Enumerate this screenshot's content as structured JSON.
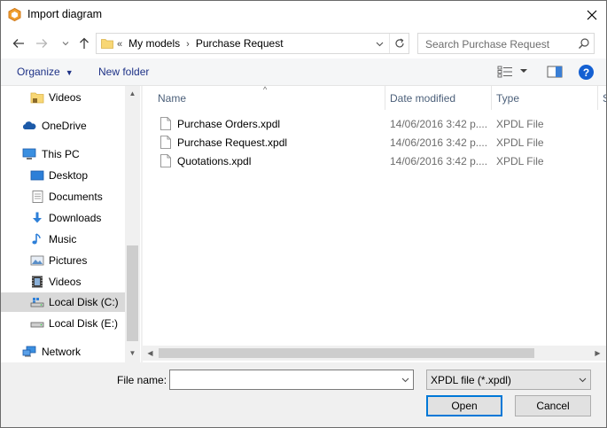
{
  "window": {
    "title": "Import diagram",
    "app_icon": "app-logo-icon",
    "close_icon": "close-icon"
  },
  "nav": {
    "back_icon": "back-arrow-icon",
    "forward_icon": "forward-arrow-icon",
    "recent_icon": "chevron-down-icon",
    "up_icon": "up-arrow-icon",
    "address": {
      "overflow_glyph": "«",
      "crumbs": [
        "My models",
        "Purchase Request"
      ],
      "separator": "›"
    },
    "search_placeholder": "Search Purchase Request"
  },
  "toolbar": {
    "organize_label": "Organize",
    "organize_caret": "▼",
    "new_folder_label": "New folder",
    "help_label": "?"
  },
  "sidebar": {
    "items": [
      {
        "label": "Videos",
        "icon": "folder-icon"
      },
      {
        "label": "OneDrive",
        "icon": "cloud-icon"
      },
      {
        "label": "This PC",
        "icon": "computer-icon"
      },
      {
        "label": "Desktop",
        "icon": "desktop-icon"
      },
      {
        "label": "Documents",
        "icon": "documents-icon"
      },
      {
        "label": "Downloads",
        "icon": "download-arrow-icon"
      },
      {
        "label": "Music",
        "icon": "music-note-icon"
      },
      {
        "label": "Pictures",
        "icon": "pictures-icon"
      },
      {
        "label": "Videos",
        "icon": "film-icon"
      },
      {
        "label": "Local Disk (C:)",
        "icon": "drive-icon"
      },
      {
        "label": "Local Disk (E:)",
        "icon": "drive-icon"
      },
      {
        "label": "Network",
        "icon": "network-icon"
      }
    ],
    "selected": "Local Disk (C:)"
  },
  "filelist": {
    "columns": [
      "Name",
      "Date modified",
      "Type",
      "S"
    ],
    "sort_glyph": "^",
    "rows": [
      {
        "name": "Purchase Orders.xpdl",
        "date": "14/06/2016 3:42 p....",
        "type": "XPDL File"
      },
      {
        "name": "Purchase Request.xpdl",
        "date": "14/06/2016 3:42 p....",
        "type": "XPDL File"
      },
      {
        "name": "Quotations.xpdl",
        "date": "14/06/2016 3:42 p....",
        "type": "XPDL File"
      }
    ]
  },
  "bottom": {
    "file_name_label": "File name:",
    "file_name_value": "",
    "file_type": "XPDL file (*.xpdl)",
    "open_label": "Open",
    "cancel_label": "Cancel"
  },
  "colors": {
    "link_blue": "#1e3287",
    "help_blue": "#1460d2",
    "focus_blue": "#0078d7",
    "header_text": "#4c607a",
    "selection_gray": "#d9d9d9"
  }
}
